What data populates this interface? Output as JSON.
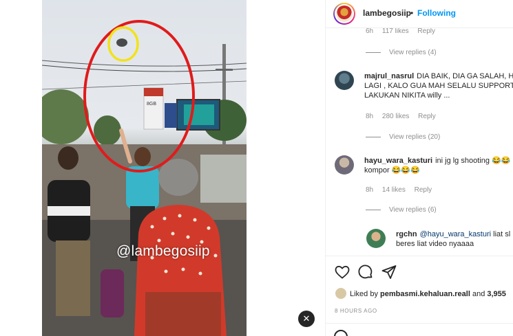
{
  "video": {
    "watermark": "@lambegosiip",
    "mute_icon": "speaker-mute-icon",
    "mute_glyph": "✕",
    "sign_text": "8GB"
  },
  "post": {
    "username": "lambegosiip",
    "separator": "•",
    "follow_state": "Following",
    "liked_prefix": "Liked by",
    "liked_user": "pembasmi.kehaluan.reall",
    "liked_and": "and",
    "liked_count": "3,955",
    "time_ago": "8 HOURS AGO"
  },
  "comments": {
    "top_meta": {
      "age": "6h",
      "likes": "117 likes",
      "reply": "Reply"
    },
    "top_view_replies": "View replies (4)",
    "items": [
      {
        "user": "majrul_nasrul",
        "text": "DIA BAIK, DIA GA SALAH, H LAGI , KALO GUA MAH SELALU SUPPORT LAKUKAN NIKITA willy ...",
        "age": "8h",
        "likes": "280 likes",
        "reply": "Reply",
        "view_replies": "View replies (20)"
      },
      {
        "user": "hayu_wara_kasturi",
        "text": "ini jg lg shooting 😂😂 kompor 😂😂😂",
        "age": "8h",
        "likes": "14 likes",
        "reply": "Reply",
        "view_replies": "View replies (6)"
      }
    ],
    "reply_item": {
      "user": "rgchn",
      "mention": "@hayu_wara_kasturi",
      "text": "liat sl beres liat video nyaaaa"
    }
  },
  "icons": {
    "like": "heart-icon",
    "comment": "comment-bubble-icon",
    "share": "paper-plane-icon",
    "emoji": "smiley-icon"
  },
  "colors": {
    "accent": "#0095f6",
    "text": "#262626",
    "muted": "#8e8e8e",
    "highlight_red": "#e01b1b",
    "highlight_yellow": "#f2e21b"
  }
}
